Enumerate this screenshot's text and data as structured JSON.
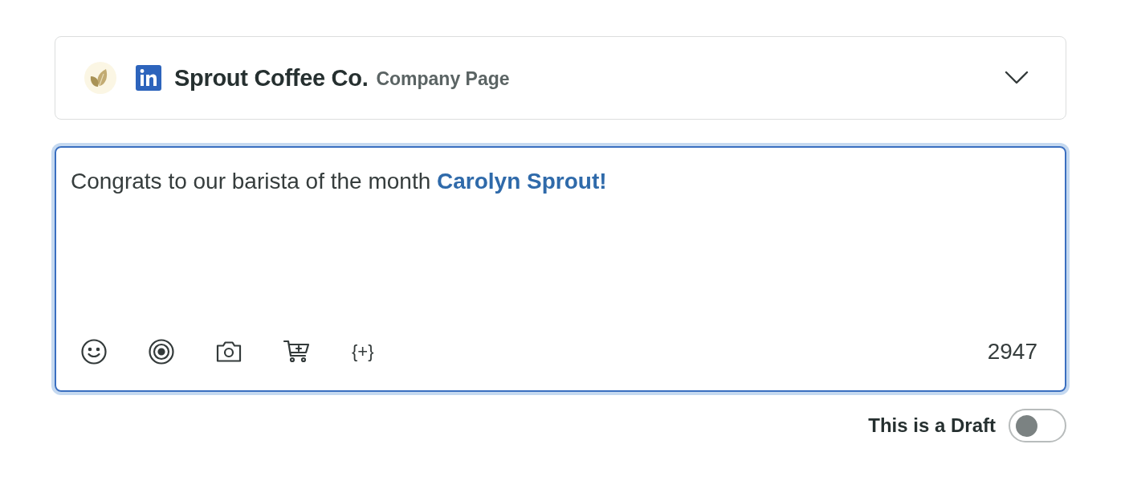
{
  "account": {
    "name": "Sprout Coffee Co.",
    "type": "Company Page",
    "expanded": false
  },
  "composer": {
    "message": "Congrats to our barista of the month **Carolyn Sprout!**",
    "focused": true,
    "tools": [
      {
        "kind": "emoji"
      },
      {
        "kind": "target"
      },
      {
        "kind": "photo"
      },
      {
        "kind": "cart"
      },
      {
        "kind": "variable",
        "label": "{+}"
      }
    ],
    "count": "2947"
  },
  "draft": {
    "label": "This is a Draft",
    "on": false
  }
}
